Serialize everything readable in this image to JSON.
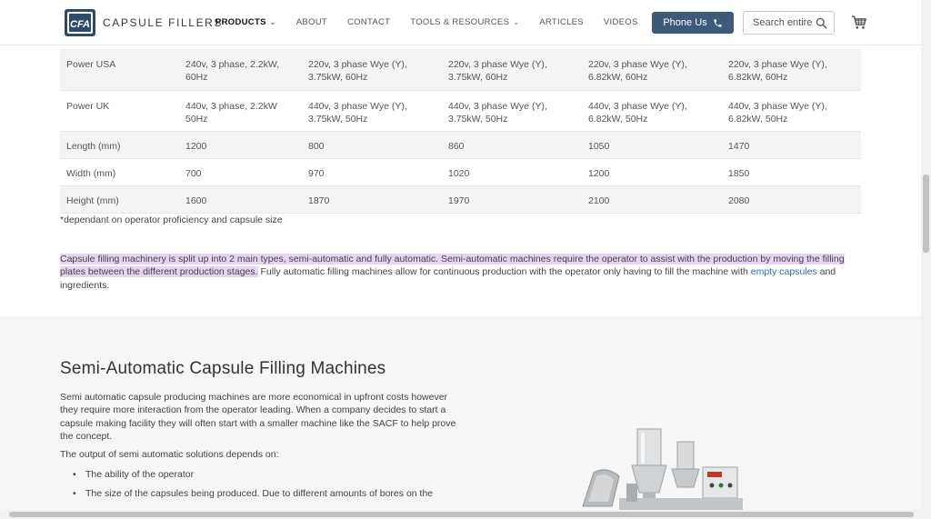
{
  "header": {
    "brand": "CAPSULE FILLERS",
    "logo_text": "CFA",
    "nav": [
      {
        "label": "PRODUCTS",
        "has_dropdown": true,
        "active": true
      },
      {
        "label": "ABOUT",
        "has_dropdown": false
      },
      {
        "label": "CONTACT",
        "has_dropdown": false
      },
      {
        "label": "TOOLS & RESOURCES",
        "has_dropdown": true
      },
      {
        "label": "ARTICLES",
        "has_dropdown": false
      },
      {
        "label": "VIDEOS",
        "has_dropdown": false
      }
    ],
    "phone_label": "Phone Us",
    "search_placeholder": "Search entire",
    "colors": {
      "phone_button": "#3e5a7a"
    }
  },
  "spec_table": {
    "rows": [
      {
        "label": "Power USA",
        "values": [
          "240v, 3 phase, 2.2kW, 60Hz",
          "220v, 3 phase Wye (Y), 3.75kW, 60Hz",
          "220v, 3 phase Wye (Y), 3.75kW, 60Hz",
          "220v, 3 phase Wye (Y), 6.82kW, 60Hz",
          "220v, 3 phase Wye (Y), 6.82kW, 60Hz"
        ]
      },
      {
        "label": "Power UK",
        "values": [
          "440v, 3 phase, 2.2kW 50Hz",
          "440v, 3 phase Wye (Y), 3.75kW, 50Hz",
          "440v, 3 phase Wye (Y), 3.75kW, 50Hz",
          "440v, 3 phase Wye (Y), 6.82kW, 50Hz",
          "440v, 3 phase Wye (Y), 6.82kW, 50Hz"
        ]
      },
      {
        "label": "Length (mm)",
        "values": [
          "1200",
          "800",
          "860",
          "1050",
          "1470"
        ]
      },
      {
        "label": "Width (mm)",
        "values": [
          "700",
          "970",
          "1020",
          "1200",
          "1850"
        ]
      },
      {
        "label": "Height (mm)",
        "values": [
          "1600",
          "1870",
          "1970",
          "2100",
          "2080"
        ]
      }
    ],
    "footnote": "*dependant on operator proficiency and capsule size"
  },
  "intro": {
    "highlighted": "Capsule filling machinery is split up into 2 main types, semi-automatic and fully automatic. Semi-automatic machines require the operator to assist with the production by moving the filling plates between the different production stages.",
    "plain": " Fully automatic filling machines allow for continuous production with the operator only having to fill the machine with ",
    "link": "empty capsules",
    "tail": " and ingredients."
  },
  "semi_auto": {
    "title": "Semi-Automatic Capsule Filling Machines",
    "body": "Semi automatic capsule producing machines are more economical in upfront costs however they require more interaction from the operator leading. When a company decides to start a capsule making facility they will often start with a smaller machine like the SACF to help prove the concept.",
    "output_intro": "The output of semi automatic solutions depends on:",
    "bullets": [
      "The ability of the operator",
      "The size of the capsules being produced. Due to different amounts of bores on the"
    ]
  }
}
